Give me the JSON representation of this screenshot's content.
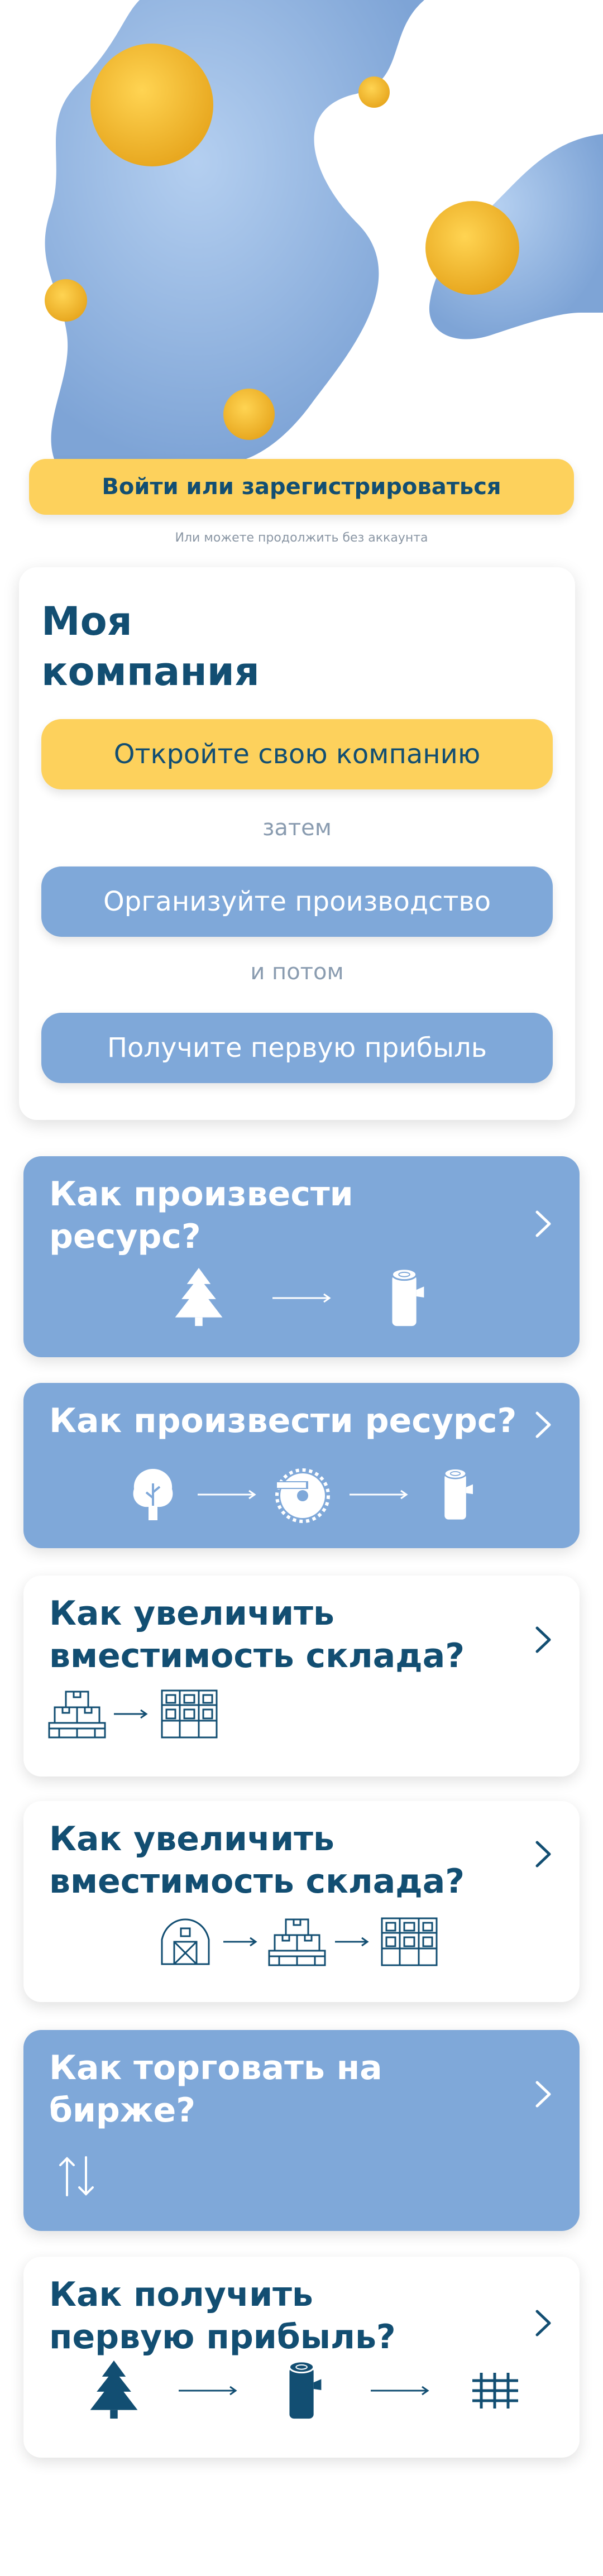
{
  "auth": {
    "login_label": "Войти или зарегистрироваться",
    "guest_note": "Или можете продолжить без аккаунта"
  },
  "company": {
    "title": "Моя компания",
    "steps": [
      "Откройте свою компанию",
      "Организуйте производство",
      "Получите первую прибыль"
    ],
    "connectors": [
      "затем",
      "и потом"
    ]
  },
  "guides": [
    {
      "title": "Как произвести ресурс?",
      "style": "blue",
      "icons": [
        "fir-tree-icon",
        "arrow-right-icon",
        "log-icon"
      ]
    },
    {
      "title": "Как произвести ресурс?",
      "style": "blue",
      "icons": [
        "tree-icon",
        "arrow-right-icon",
        "sawmill-icon",
        "arrow-right-icon",
        "log-icon"
      ]
    },
    {
      "title": "Как увеличить вместимость склада?",
      "style": "white",
      "icons": [
        "boxes-on-pallet-icon",
        "arrow-right-icon",
        "shelving-icon"
      ]
    },
    {
      "title": "Как увеличить вместимость склада?",
      "style": "white",
      "icons": [
        "barn-icon",
        "arrow-right-icon",
        "boxes-on-pallet-icon",
        "arrow-right-icon",
        "shelving-icon"
      ]
    },
    {
      "title": "Как торговать на бирже?",
      "style": "blue",
      "icons": [
        "up-down-arrows-icon"
      ]
    },
    {
      "title": "Как получить первую прибыль?",
      "style": "white",
      "icons": [
        "fir-tree-icon",
        "arrow-right-icon",
        "log-icon",
        "arrow-right-icon",
        "planks-icon"
      ]
    }
  ],
  "colors": {
    "brand_dark": "#124e72",
    "accent_yellow": "#fdd15c",
    "card_blue": "#7fa8d9",
    "blob_blue": "#8fb3df"
  }
}
